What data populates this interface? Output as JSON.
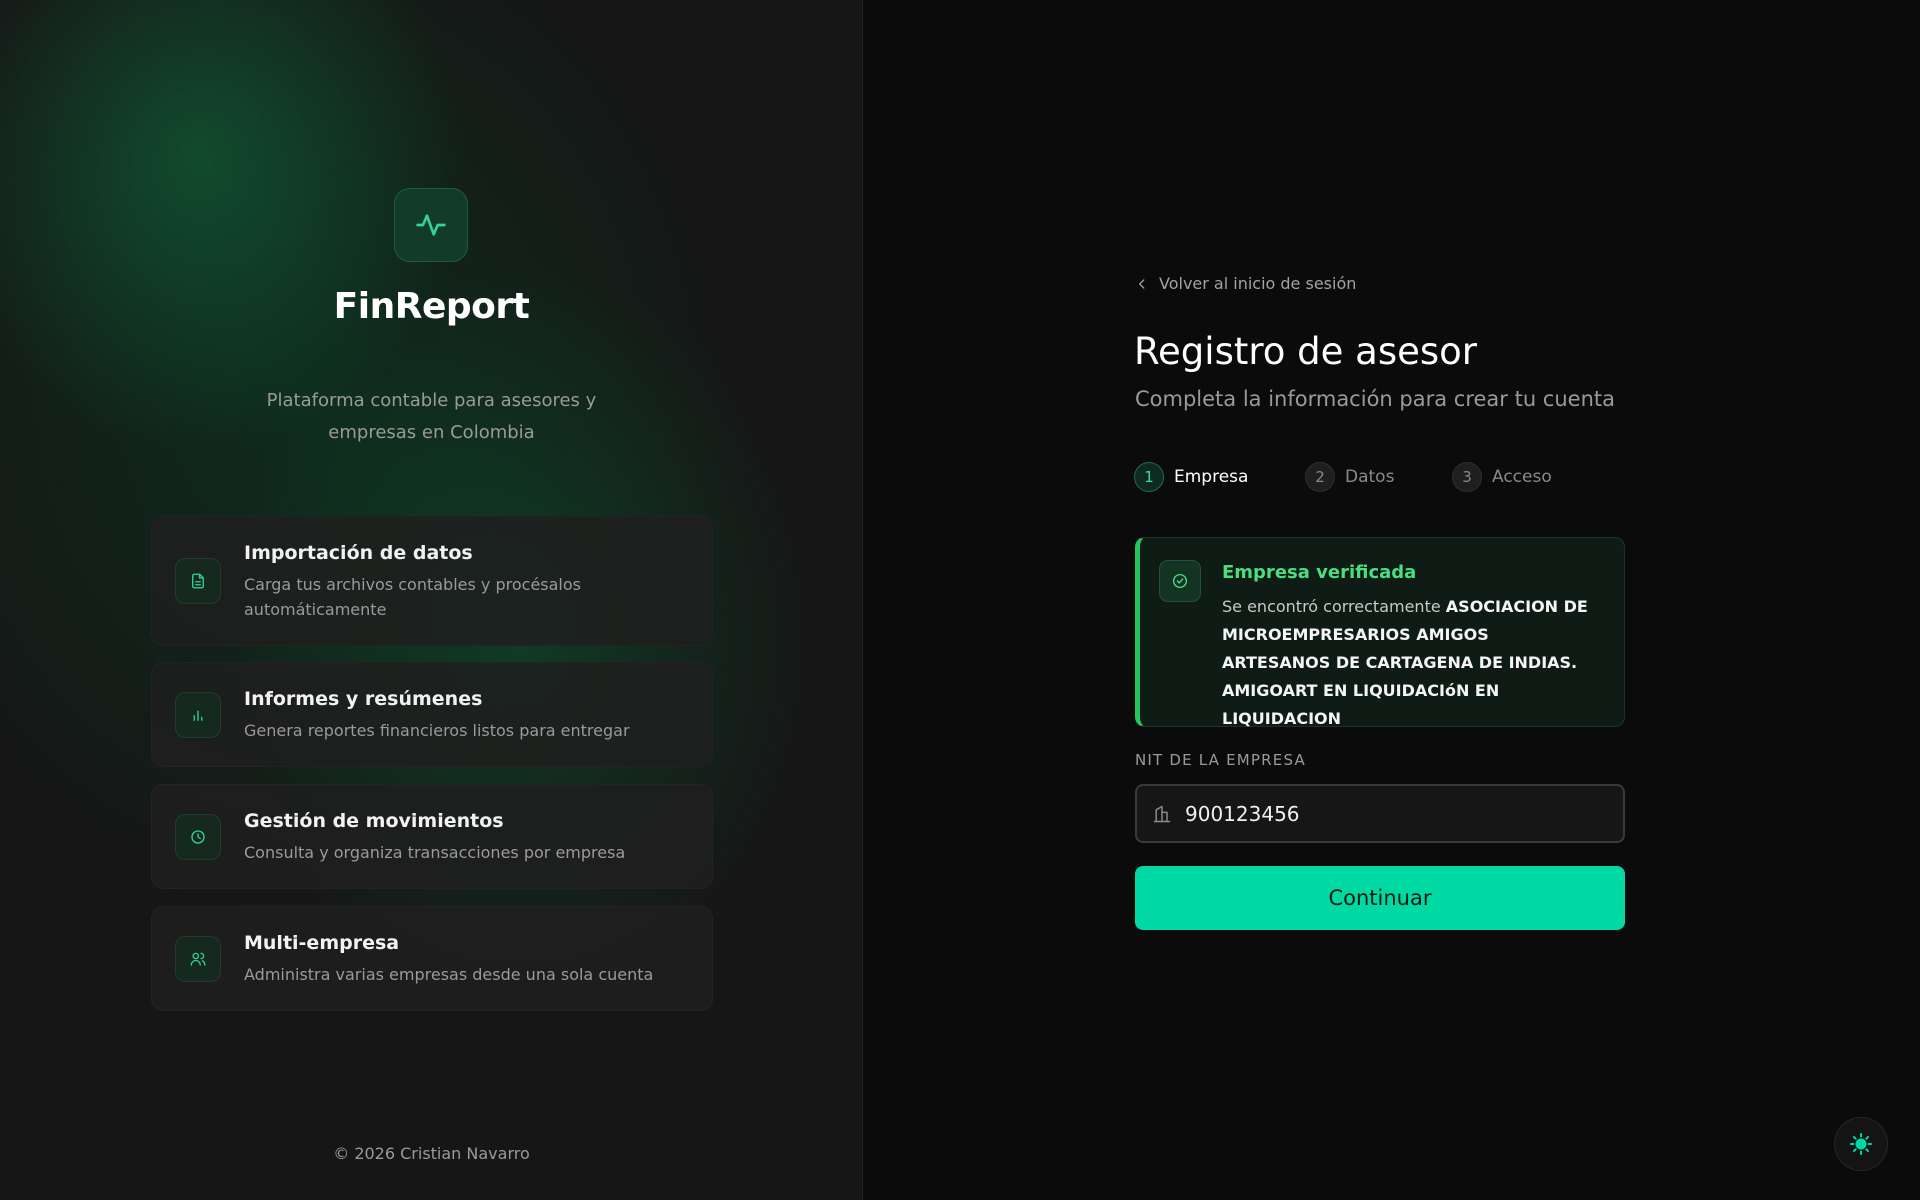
{
  "brand": {
    "name": "FinReport",
    "tagline": "Plataforma contable para asesores y empresas en Colombia",
    "accent": "#00d9a3"
  },
  "features": [
    {
      "icon": "document-icon",
      "title": "Importación de datos",
      "description": "Carga tus archivos contables y procésalos automáticamente"
    },
    {
      "icon": "bar-chart-icon",
      "title": "Informes y resúmenes",
      "description": "Genera reportes financieros listos para entregar"
    },
    {
      "icon": "clock-icon",
      "title": "Gestión de movimientos",
      "description": "Consulta y organiza transacciones por empresa"
    },
    {
      "icon": "users-icon",
      "title": "Multi-empresa",
      "description": "Administra varias empresas desde una sola cuenta"
    }
  ],
  "footer": {
    "copyright": "© 2026 Cristian Navarro"
  },
  "form": {
    "back_link": "Volver al inicio de sesión",
    "title": "Registro de asesor",
    "subtitle": "Completa la información para crear tu cuenta",
    "steps": [
      {
        "number": "1",
        "label": "Empresa",
        "state": "active"
      },
      {
        "number": "2",
        "label": "Datos",
        "state": "idle"
      },
      {
        "number": "3",
        "label": "Acceso",
        "state": "idle"
      }
    ],
    "alert": {
      "title": "Empresa verificada",
      "prefix": "Se encontró correctamente",
      "company": "ASOCIACION DE MICROEMPRESARIOS AMIGOS ARTESANOS DE CARTAGENA DE INDIAS. AMIGOART EN LIQUIDACIóN EN LIQUIDACION",
      "color": "#22c55e"
    },
    "nit": {
      "label": "NIT DE LA EMPRESA",
      "value": "900123456",
      "icon": "building-icon"
    },
    "submit_label": "Continuar"
  },
  "theme_toggle": {
    "icon": "sun-icon"
  }
}
